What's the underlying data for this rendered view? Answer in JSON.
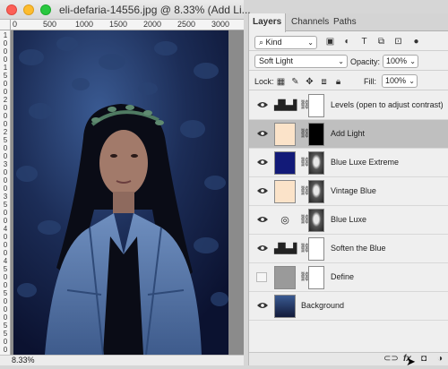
{
  "document": {
    "title": "eli-defaria-14556.jpg @ 8.33% (Add Li...",
    "zoom": "8.33%",
    "ruler_top": [
      "0",
      "500",
      "1000",
      "1500",
      "2000",
      "2500",
      "3000"
    ],
    "ruler_left": [
      "1",
      "0",
      "0",
      "0",
      "1",
      "5",
      "0",
      "0",
      "2",
      "0",
      "0",
      "0",
      "2",
      "5",
      "0",
      "0",
      "3",
      "0",
      "0",
      "0",
      "3",
      "5",
      "0",
      "0",
      "4",
      "0",
      "0",
      "0",
      "4",
      "5",
      "0",
      "0",
      "5",
      "0",
      "0",
      "0",
      "5",
      "5",
      "0",
      "0"
    ]
  },
  "panel": {
    "tabs": [
      "Layers",
      "Channels",
      "Paths"
    ],
    "filter_kind": "Kind",
    "blend_mode": "Soft Light",
    "opacity_label": "Opacity:",
    "opacity_value": "100%",
    "lock_label": "Lock:",
    "fill_label": "Fill:",
    "fill_value": "100%",
    "layers": [
      {
        "name": "Levels (open to adjust contrast)",
        "visible": true,
        "icon": "levels-icon",
        "thumb_color": "#ffffff",
        "mask_color": "#ffffff",
        "selected": false
      },
      {
        "name": "Add Light",
        "visible": true,
        "icon": "color-fill",
        "thumb_color": "#fbe3c9",
        "mask_color": "#000000",
        "selected": true
      },
      {
        "name": "Blue Luxe Extreme",
        "visible": true,
        "icon": "color-fill",
        "thumb_color": "#121a78",
        "mask_color": "portrait",
        "selected": false
      },
      {
        "name": "Vintage Blue",
        "visible": true,
        "icon": "color-fill",
        "thumb_color": "#fbe3c9",
        "mask_color": "portrait",
        "selected": false
      },
      {
        "name": "Blue Luxe",
        "visible": true,
        "icon": "camera-icon",
        "thumb_color": "#ffffff",
        "mask_color": "portrait",
        "selected": false
      },
      {
        "name": "Soften the Blue",
        "visible": true,
        "icon": "levels-icon",
        "thumb_color": "#ffffff",
        "mask_color": "#ffffff",
        "selected": false
      },
      {
        "name": "Define",
        "visible": false,
        "icon": "gray-photo",
        "thumb_color": "#9a9a9a",
        "mask_color": "#ffffff",
        "selected": false
      },
      {
        "name": "Background",
        "visible": true,
        "icon": "photo",
        "thumb_color": "#2d3e66",
        "mask_color": "",
        "selected": false
      }
    ],
    "footer_icons": [
      "link-icon",
      "fx-icon",
      "mask-icon",
      "adjustment-icon"
    ]
  }
}
